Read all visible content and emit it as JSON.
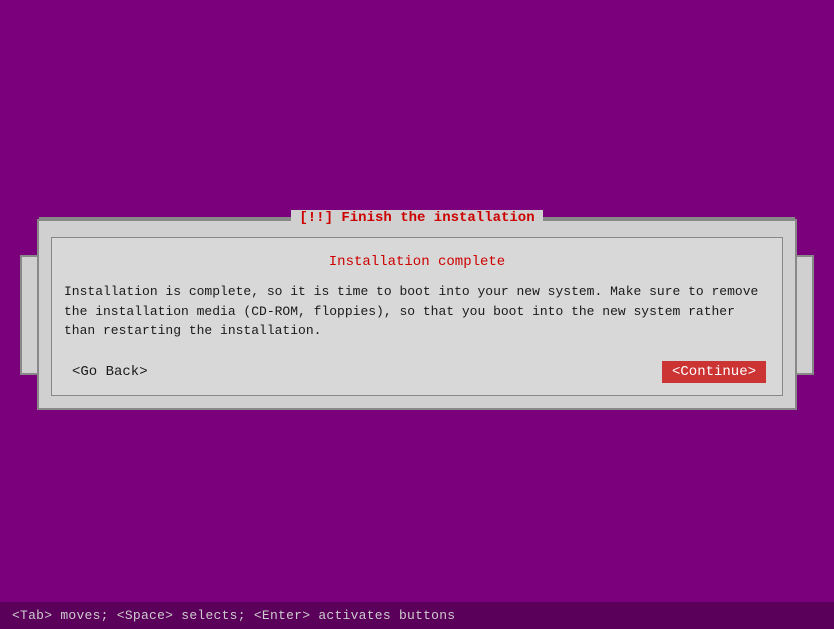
{
  "dialog": {
    "title": "[!!] Finish the installation",
    "subtitle": "Installation complete",
    "body": "Installation is complete, so it is time to boot into your new system. Make sure to remove\nthe installation media (CD-ROM, floppies), so that you boot into the new system rather\nthan restarting the installation.",
    "go_back_label": "<Go Back>",
    "continue_label": "<Continue>"
  },
  "bottom_bar": {
    "text": "<Tab> moves; <Space> selects; <Enter> activates buttons"
  }
}
